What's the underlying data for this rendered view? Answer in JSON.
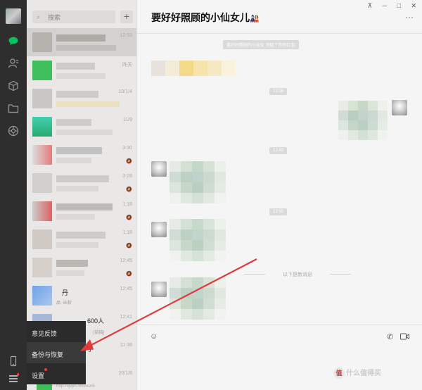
{
  "window": {
    "pin_icon": "pin-icon",
    "minimize_label": "─",
    "maximize_label": "□",
    "close_label": "✕"
  },
  "sidebar": {
    "icons": [
      "chat-icon",
      "contacts-icon",
      "favorites-cube-icon",
      "files-folder-icon",
      "moments-icon",
      "phone-icon",
      "menu-icon"
    ]
  },
  "search": {
    "placeholder": "搜索",
    "add_label": "+"
  },
  "chat_list": [
    {
      "time": "12:53",
      "muted": false
    },
    {
      "time": "昨天",
      "muted": false
    },
    {
      "time": "10/1/4",
      "muted": false
    },
    {
      "time": "11/9",
      "muted": false
    },
    {
      "time": "3:30",
      "muted": true
    },
    {
      "time": "3:28",
      "muted": true
    },
    {
      "time": "1:18",
      "muted": true
    },
    {
      "time": "1:18",
      "muted": true
    },
    {
      "time": "12:45",
      "muted": true
    },
    {
      "time": "12:41",
      "muted": true
    },
    {
      "time": "11:38",
      "muted": false
    },
    {
      "time": "20/1/6",
      "muted": false
    }
  ],
  "chat_list_fragments": {
    "row9_name": "丹",
    "row9_preview": "品: 95折",
    "row10_name": "600人",
    "row10_preview": "[链接]",
    "row11_name": "手",
    "row13_preview": "http://vjejin.im/post/5"
  },
  "chat": {
    "title": "要好好照顾的小仙女儿",
    "system_notice": "要好好照顾的小仙女  领取了你的红包",
    "times": [
      "12:38",
      "12:43",
      "12:50"
    ],
    "new_messages_divider": "以下是新消息",
    "more_label": "···",
    "toolbar_icons": [
      "emoji-icon",
      "phone-call-icon",
      "video-call-icon"
    ]
  },
  "popup_menu": {
    "items": [
      "意见反馈",
      "备份与恢复",
      "设置"
    ],
    "highlighted": "备份与恢复"
  },
  "watermark": {
    "text": "什么值得买",
    "badge": "值"
  },
  "colors": {
    "sidebar_bg": "#2e2e2e",
    "accent_green": "#07c160",
    "annotation_red": "#e03a3a"
  }
}
